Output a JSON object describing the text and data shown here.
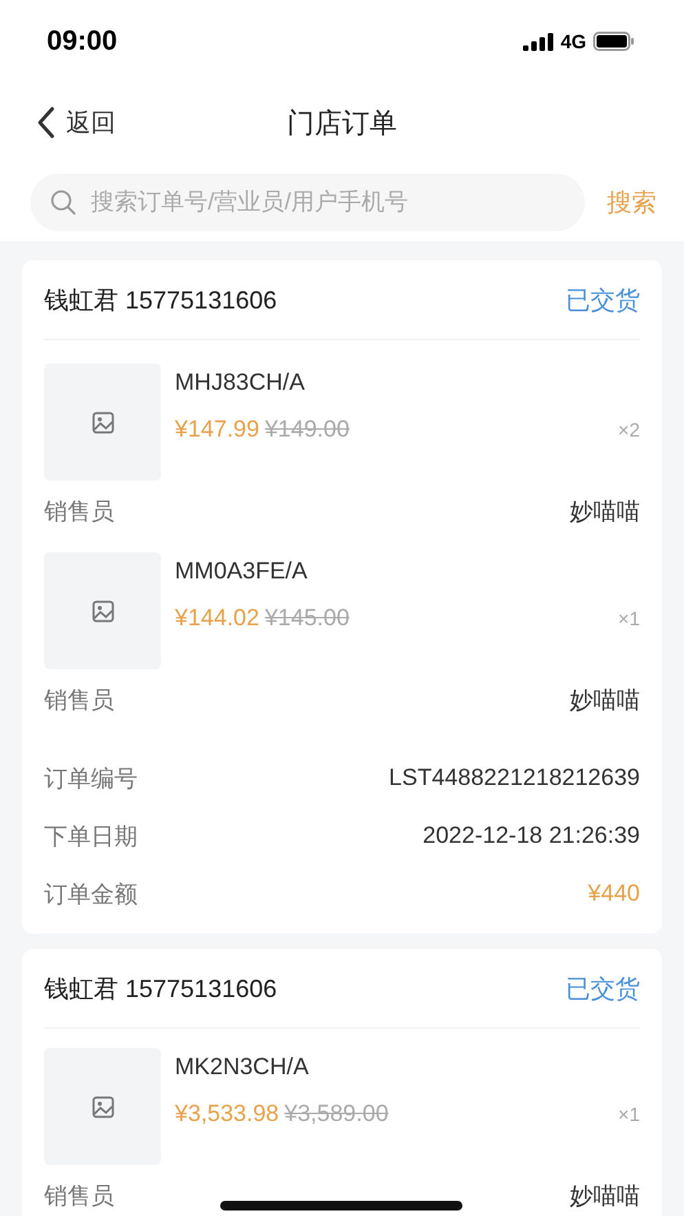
{
  "status_bar": {
    "time": "09:00",
    "network": "4G"
  },
  "nav": {
    "back": "返回",
    "title": "门店订单"
  },
  "search": {
    "placeholder": "搜索订单号/营业员/用户手机号",
    "button": "搜索"
  },
  "orders": [
    {
      "customer": "钱虹君 15775131606",
      "status": "已交货",
      "items": [
        {
          "sku": "MHJ83CH/A",
          "price": "¥147.99",
          "original_price": "¥149.00",
          "quantity": "×2",
          "seller_label": "销售员",
          "seller": "妙喵喵"
        },
        {
          "sku": "MM0A3FE/A",
          "price": "¥144.02",
          "original_price": "¥145.00",
          "quantity": "×1",
          "seller_label": "销售员",
          "seller": "妙喵喵"
        }
      ],
      "details": [
        {
          "label": "订单编号",
          "value": "LST4488221218212639",
          "kind": "plain"
        },
        {
          "label": "下单日期",
          "value": "2022-12-18 21:26:39",
          "kind": "plain"
        },
        {
          "label": "订单金额",
          "value": "¥440",
          "kind": "amount"
        }
      ]
    },
    {
      "customer": "钱虹君 15775131606",
      "status": "已交货",
      "items": [
        {
          "sku": "MK2N3CH/A",
          "price": "¥3,533.98",
          "original_price": "¥3,589.00",
          "quantity": "×1",
          "seller_label": "销售员",
          "seller": "妙喵喵"
        }
      ]
    }
  ]
}
